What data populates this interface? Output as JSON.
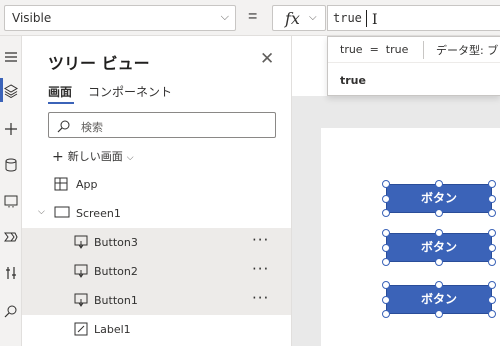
{
  "formula_bar": {
    "property": "Visible",
    "equals": "=",
    "fx_label": "fx",
    "formula": "true"
  },
  "intellisense": {
    "evaluation": "true  =  true",
    "data_type": "データ型: ブ",
    "result": "true"
  },
  "tree_view": {
    "title": "ツリー ビュー",
    "tabs": [
      "画面",
      "コンポーネント"
    ],
    "search_placeholder": "検索",
    "new_screen": "新しい画面",
    "items": [
      {
        "label": "App"
      },
      {
        "label": "Screen1"
      },
      {
        "label": "Button3",
        "more": "···"
      },
      {
        "label": "Button2",
        "more": "···"
      },
      {
        "label": "Button1",
        "more": "···"
      },
      {
        "label": "Label1"
      }
    ]
  },
  "canvas": {
    "buttons": [
      "ボタン",
      "ボタン",
      "ボタン"
    ]
  },
  "colors": {
    "accent": "#3b63b8",
    "selected_row": "#edebe9",
    "rail": "#f3f2f1"
  },
  "icons": [
    "hamburger-icon",
    "layers-icon",
    "plus-icon",
    "database-icon",
    "media-icon",
    "power-automate-icon",
    "tools-icon",
    "search-icon",
    "close-icon",
    "app-icon",
    "screen-icon",
    "button-icon",
    "label-icon"
  ]
}
